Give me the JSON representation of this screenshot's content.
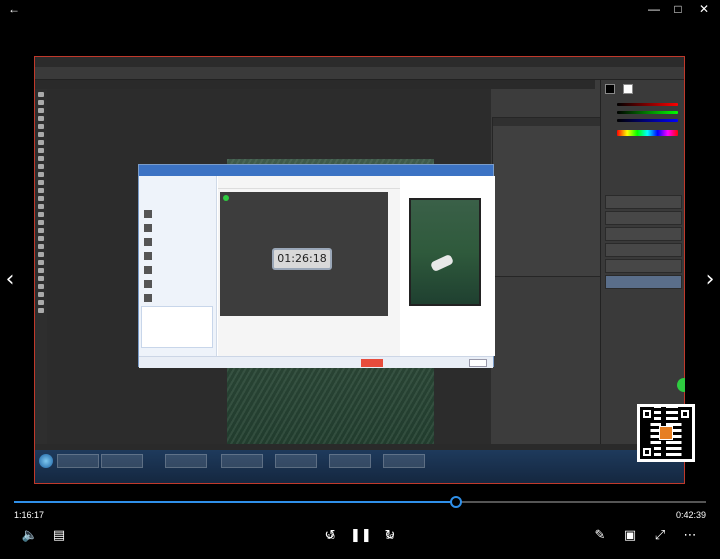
{
  "titlebar": {
    "back_icon": "back-arrow-icon",
    "minimize_icon": "minimize-icon",
    "maximize_icon": "maximize-icon",
    "close_icon": "close-icon"
  },
  "navigation": {
    "prev_icon": "chevron-left-icon",
    "next_icon": "chevron-right-icon"
  },
  "video_content": {
    "share_timer": "01:26:18",
    "accent_color": "#2f8fe8"
  },
  "playback": {
    "current_time": "1:16:17",
    "total_time": "0:42:39",
    "progress": 0.639
  },
  "controls": {
    "rewind_seconds": "10",
    "forward_seconds": "30",
    "volume_icon": "volume-icon",
    "subtitles_icon": "subtitles-icon",
    "rewind_icon": "rewind-icon",
    "pause_icon": "pause-icon",
    "forward_icon": "forward-icon",
    "edit_icon": "pencil-icon",
    "miniview_icon": "mini-view-icon",
    "fullscreen_icon": "fullscreen-icon",
    "more_icon": "more-icon"
  }
}
